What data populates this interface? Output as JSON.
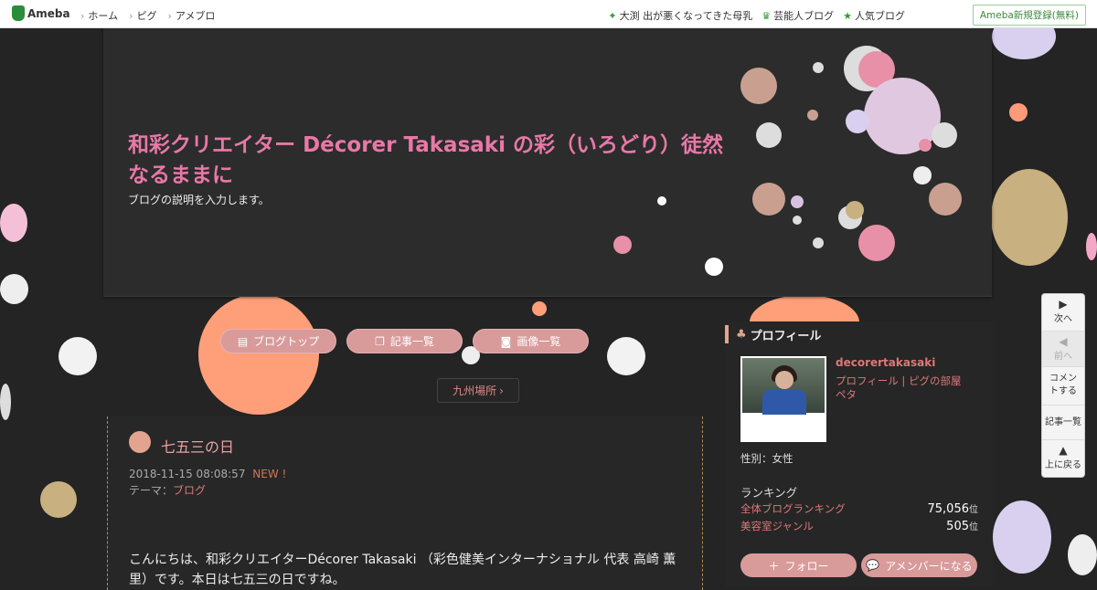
{
  "global_nav": {
    "logo_text": "Ameba",
    "left_links": [
      "ホーム",
      "ピグ",
      "アメブロ"
    ],
    "right_links": [
      "大渕 出が悪くなってきた母乳",
      "芸能人ブログ",
      "人気ブログ"
    ],
    "register_label": "Ameba新規登録(無料)"
  },
  "header": {
    "title": "和彩クリエイター Décorer Takasaki の彩（いろどり）徒然なるままに",
    "description": "ブログの説明を入力します。"
  },
  "menu": {
    "blog_top": "ブログトップ",
    "article_list": "記事一覧",
    "image_list": "画像一覧"
  },
  "breadcrumb_chip": "九州場所",
  "article": {
    "title": "七五三の日",
    "date": "2018-11-15 08:08:57",
    "new_badge": "NEW !",
    "theme_label": "テーマ：",
    "theme_value": "ブログ",
    "body": "こんにちは、和彩クリエイターDécorer Takasaki （彩色健美インターナショナル 代表 高崎 薫里）です。本日は七五三の日ですね。"
  },
  "profile": {
    "heading": "プロフィール",
    "username": "decorertakasaki",
    "link1": "プロフィール",
    "link2": "ピグの部屋",
    "link3": "ペタ",
    "sex": "性別：女性",
    "ranking_label": "ランキング",
    "rank1_label": "全体ブログランキング",
    "rank1_value": "75,056",
    "rank2_label": "美容室ジャンル",
    "rank2_value": "505",
    "rank_unit": "位",
    "follow_label": "フォロー",
    "member_label": "アメンバーになる"
  },
  "side_nav": {
    "next": "次へ",
    "prev": "前へ",
    "comment": "コメントする",
    "list": "記事一覧",
    "top": "上に戻る"
  },
  "colors": {
    "accent_pink": "#e878a8",
    "button_pink": "#d99a9a",
    "link_red": "#dd7777"
  }
}
